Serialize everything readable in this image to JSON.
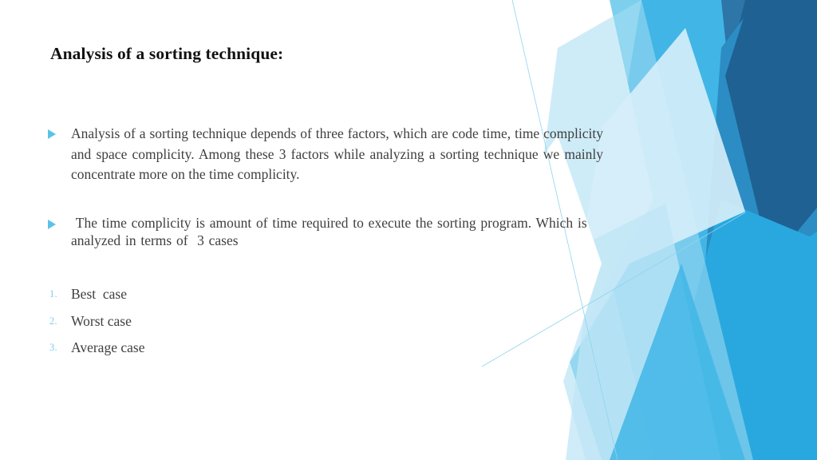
{
  "slide": {
    "title": "Analysis of a sorting technique:",
    "background_color": "#FFFFFF",
    "text_color": "#3F3F3F",
    "accent_color": "#5BC2E7"
  },
  "bullets": [
    {
      "marker": "triangle-bullet",
      "text": "Analysis of a sorting technique depends of three factors, which are code time, time complicity and space complicity. Among these 3 factors while analyzing a sorting technique we mainly concentrate more on the time complicity."
    },
    {
      "marker": "triangle-bullet",
      "text": " The time complicity is amount of time required to execute the sorting program. Which is analyzed in terms of  3 cases"
    }
  ],
  "numbered_list": [
    {
      "number": "1.",
      "label": "Best  case"
    },
    {
      "number": "2.",
      "label": "Worst case"
    },
    {
      "number": "3.",
      "label": "Average case"
    }
  ],
  "decoration": {
    "name": "angular-blue-polygons",
    "colors": {
      "pale_blue": "#D7EEF9",
      "light_blue": "#A6DDF2",
      "sky_blue": "#7DD0ED",
      "cyan_blue": "#41B6E6",
      "bright_blue": "#29A8DF",
      "mid_blue": "#2B8DC4",
      "steel_blue": "#2E75A8",
      "deep_blue": "#1F6193",
      "hairline": "#8FD4EC"
    }
  }
}
